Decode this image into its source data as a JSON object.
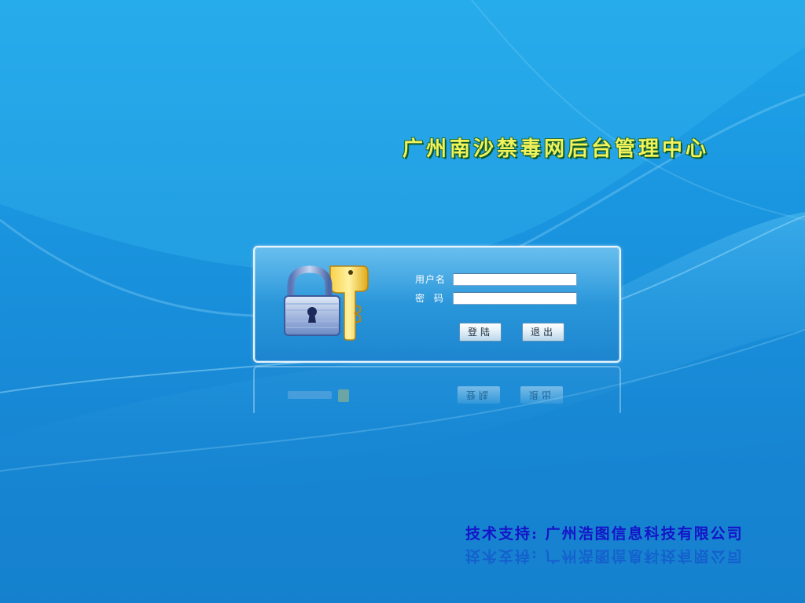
{
  "header": {
    "title": "广州南沙禁毒网后台管理中心"
  },
  "login": {
    "username_label": "用户名",
    "password_label": "密 码",
    "username_value": "",
    "password_value": "",
    "login_button": "登陆",
    "exit_button": "退出"
  },
  "footer": {
    "credit": "技术支持: 广州浩图信息科技有限公司"
  },
  "icons": {
    "lock": "padlock-icon",
    "key": "key-icon"
  },
  "colors": {
    "background": "#1a95df",
    "title": "#f2f25a",
    "footer_text": "#1414c8",
    "panel_border": "#e8f4fc"
  }
}
